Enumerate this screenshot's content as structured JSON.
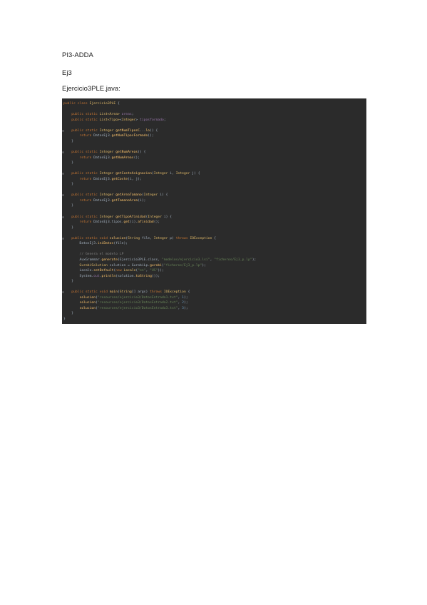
{
  "document": {
    "heading_project": "PI3-ADDA",
    "heading_exercise": "Ej3",
    "heading_file": "Ejercicio3PLE.java:"
  },
  "code": {
    "lines": [
      [
        [
          "kw",
          "public class "
        ],
        [
          "ty",
          "Ejercicio3PLE"
        ],
        [
          "nm",
          " {"
        ]
      ],
      [],
      [
        [
          "kw",
          "    public static "
        ],
        [
          "ty",
          "List<Area>"
        ],
        [
          "fd",
          " areas"
        ],
        [
          "nm",
          ";"
        ]
      ],
      [
        [
          "kw",
          "    public static "
        ],
        [
          "ty",
          "List<Tipo>"
        ],
        [
          "nm",
          "<"
        ],
        [
          "ty",
          "Integer"
        ],
        [
          "nm",
          "> "
        ],
        [
          "fd",
          "tiposformado"
        ],
        [
          "nm",
          ";"
        ]
      ],
      [],
      [
        [
          "kw",
          "    public static "
        ],
        [
          "ty",
          "Integer"
        ],
        [
          "fn",
          " getNumTiposC"
        ],
        [
          "nm",
          "..."
        ],
        [
          "fn",
          "lo"
        ],
        [
          "nm",
          "() {"
        ]
      ],
      [
        [
          "kw",
          "        return "
        ],
        [
          "nm",
          "DatosEj3."
        ],
        [
          "fn",
          "getNumTiposFormado"
        ],
        [
          "nm",
          "();"
        ]
      ],
      [
        [
          "nm",
          "    }"
        ]
      ],
      [],
      [
        [
          "kw",
          "    public static "
        ],
        [
          "ty",
          "Integer"
        ],
        [
          "fn",
          " getNumAreas"
        ],
        [
          "nm",
          "() {"
        ]
      ],
      [
        [
          "kw",
          "        return "
        ],
        [
          "nm",
          "DatosEj3."
        ],
        [
          "fn",
          "getNumAreas"
        ],
        [
          "nm",
          "();"
        ]
      ],
      [
        [
          "nm",
          "    }"
        ]
      ],
      [],
      [
        [
          "kw",
          "    public static "
        ],
        [
          "ty",
          "Integer"
        ],
        [
          "fn",
          " getCosteAsignacion"
        ],
        [
          "nm",
          "("
        ],
        [
          "ty",
          "Integer"
        ],
        [
          "nm",
          " i, "
        ],
        [
          "ty",
          "Integer"
        ],
        [
          "nm",
          " j) {"
        ]
      ],
      [
        [
          "kw",
          "        return "
        ],
        [
          "nm",
          "DatosEj3."
        ],
        [
          "fn",
          "getCoste"
        ],
        [
          "nm",
          "(i, j);"
        ]
      ],
      [
        [
          "nm",
          "    }"
        ]
      ],
      [],
      [
        [
          "kw",
          "    public static "
        ],
        [
          "ty",
          "Integer"
        ],
        [
          "fn",
          " getAreaTamano"
        ],
        [
          "nm",
          "("
        ],
        [
          "ty",
          "Integer"
        ],
        [
          "nm",
          " i) {"
        ]
      ],
      [
        [
          "kw",
          "        return "
        ],
        [
          "nm",
          "DatosEj3."
        ],
        [
          "fn",
          "getTamanoArea"
        ],
        [
          "nm",
          "(i);"
        ]
      ],
      [
        [
          "nm",
          "    }"
        ]
      ],
      [],
      [
        [
          "kw",
          "    public static "
        ],
        [
          "ty",
          "Integer"
        ],
        [
          "fn",
          " getTipoAfinidad"
        ],
        [
          "nm",
          "("
        ],
        [
          "ty",
          "Integer"
        ],
        [
          "nm",
          " i) {"
        ]
      ],
      [
        [
          "kw",
          "        return "
        ],
        [
          "nm",
          "DatosEj3.tipos."
        ],
        [
          "fn",
          "get"
        ],
        [
          "nm",
          "(i)."
        ],
        [
          "fn",
          "afinidad"
        ],
        [
          "nm",
          "();"
        ]
      ],
      [
        [
          "nm",
          "    }"
        ]
      ],
      [],
      [
        [
          "kw",
          "    public static void "
        ],
        [
          "fn",
          "solucion"
        ],
        [
          "nm",
          "("
        ],
        [
          "ty",
          "String"
        ],
        [
          "nm",
          " file, "
        ],
        [
          "ty",
          "Integer"
        ],
        [
          "nm",
          " p) "
        ],
        [
          "kw",
          "throws "
        ],
        [
          "ty",
          "IOException"
        ],
        [
          "nm",
          " {"
        ]
      ],
      [
        [
          "nm",
          "        DatosEj3."
        ],
        [
          "fn",
          "iniDatos"
        ],
        [
          "nm",
          "(file);"
        ]
      ],
      [],
      [
        [
          "cm",
          "        // Genera el modelo LP"
        ]
      ],
      [
        [
          "nm",
          "        AuxGrammar."
        ],
        [
          "fn",
          "generate"
        ],
        [
          "nm",
          "(Ejercicio3PLE.class, "
        ],
        [
          "st",
          "\"modelos/ejercicio3.lsi\""
        ],
        [
          "nm",
          ", "
        ],
        [
          "st",
          "\"ficheros/Ej3_p.lp\""
        ],
        [
          "nm",
          ");"
        ]
      ],
      [
        [
          "ty",
          "        GurobiSolution"
        ],
        [
          "nm",
          " solution = GurobiLp."
        ],
        [
          "fn",
          "gurobi"
        ],
        [
          "nm",
          "("
        ],
        [
          "st",
          "\"ficheros/Ej3_p.lp\""
        ],
        [
          "nm",
          ");"
        ]
      ],
      [
        [
          "nm",
          "        Locale."
        ],
        [
          "fn",
          "setDefault"
        ],
        [
          "nm",
          "("
        ],
        [
          "kw",
          "new "
        ],
        [
          "ty",
          "Locale"
        ],
        [
          "nm",
          "("
        ],
        [
          "st",
          "\"en\""
        ],
        [
          "nm",
          ", "
        ],
        [
          "st",
          "\"US\""
        ],
        [
          "nm",
          "));"
        ]
      ],
      [
        [
          "nm",
          "        System."
        ],
        [
          "fd",
          "out"
        ],
        [
          "nm",
          "."
        ],
        [
          "fn",
          "println"
        ],
        [
          "nm",
          "(solution."
        ],
        [
          "fn",
          "toString"
        ],
        [
          "nm",
          "());"
        ]
      ],
      [
        [
          "nm",
          "    }"
        ]
      ],
      [],
      [
        [
          "kw",
          "    public static void "
        ],
        [
          "fn",
          "main"
        ],
        [
          "nm",
          "("
        ],
        [
          "ty",
          "String"
        ],
        [
          "nm",
          "[] args) "
        ],
        [
          "kw",
          "throws "
        ],
        [
          "ty",
          "IOException"
        ],
        [
          "nm",
          " {"
        ]
      ],
      [
        [
          "fn",
          "        solucion"
        ],
        [
          "nm",
          "("
        ],
        [
          "st",
          "\"resources/ejercicio3/DatosEntrada1.txt\""
        ],
        [
          "nm",
          ", "
        ],
        [
          "num",
          "1"
        ],
        [
          "nm",
          ");"
        ]
      ],
      [
        [
          "fn",
          "        solucion"
        ],
        [
          "nm",
          "("
        ],
        [
          "st",
          "\"resources/ejercicio3/DatosEntrada2.txt\""
        ],
        [
          "nm",
          ", "
        ],
        [
          "num",
          "2"
        ],
        [
          "nm",
          ");"
        ]
      ],
      [
        [
          "fn",
          "        solucion"
        ],
        [
          "nm",
          "("
        ],
        [
          "st",
          "\"resources/ejercicio3/DatosEntrada3.txt\""
        ],
        [
          "nm",
          ", "
        ],
        [
          "num",
          "3"
        ],
        [
          "nm",
          ");"
        ]
      ],
      [
        [
          "nm",
          "    }"
        ]
      ],
      [
        [
          "nm",
          "}"
        ]
      ]
    ]
  },
  "colors": {
    "background": "#ffffff",
    "code_background": "#2b2b2b",
    "keyword": "#cc7832",
    "type": "#e8bf6a",
    "method": "#ffc66d",
    "string": "#6a8759",
    "comment": "#808080"
  }
}
